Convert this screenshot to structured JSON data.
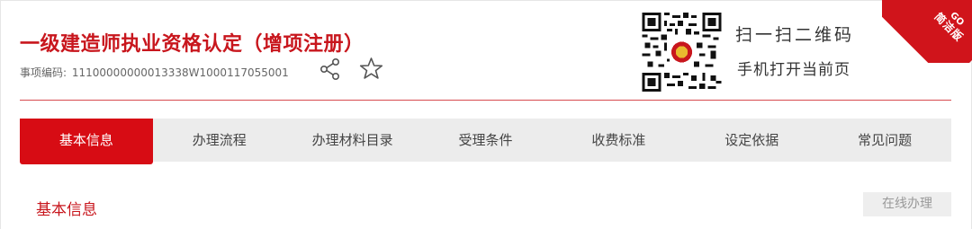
{
  "header": {
    "title": "一级建造师执业资格认定（增项注册）",
    "item_code_label": "事项编码:",
    "item_code": "11100000000013338W1000117055001"
  },
  "actions": {
    "share_icon": "share-icon",
    "favorite_icon": "star-outline-icon"
  },
  "qr": {
    "line1": "扫一扫二维码",
    "line2": "手机打开当前页"
  },
  "ribbon": {
    "go": "GO",
    "label": "简洁版",
    "color": "#d0141b"
  },
  "tabs": [
    {
      "label": "基本信息",
      "active": true
    },
    {
      "label": "办理流程",
      "active": false
    },
    {
      "label": "办理材料目录",
      "active": false
    },
    {
      "label": "受理条件",
      "active": false
    },
    {
      "label": "收费标准",
      "active": false
    },
    {
      "label": "设定依据",
      "active": false
    },
    {
      "label": "常见问题",
      "active": false
    }
  ],
  "section": {
    "title": "基本信息",
    "online_button": "在线办理"
  },
  "colors": {
    "accent": "#d70c14",
    "title": "#c8161d",
    "tab_bg": "#ececec"
  }
}
